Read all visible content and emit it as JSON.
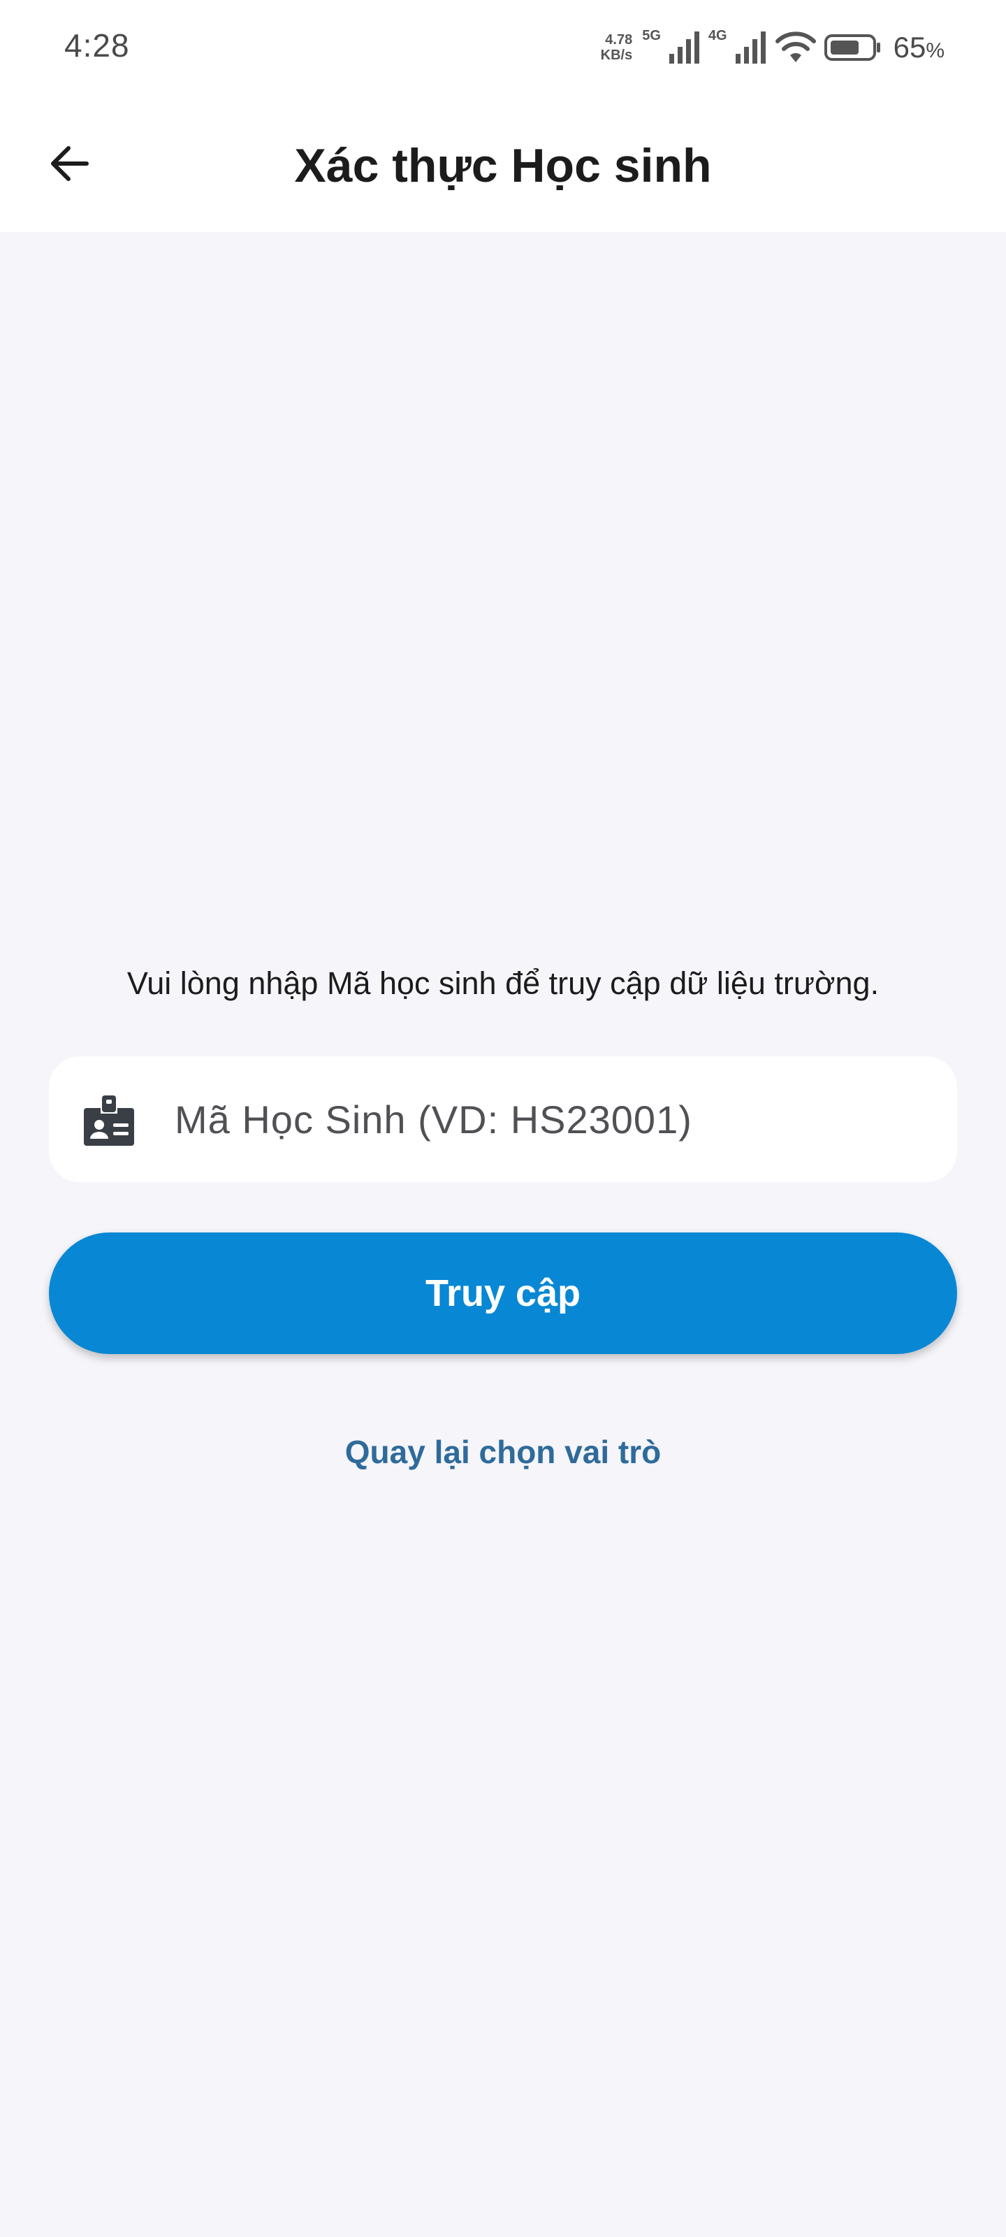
{
  "status_bar": {
    "time": "4:28",
    "net_speed_value": "4.78",
    "net_speed_unit": "KB/s",
    "signal1_label": "5G",
    "signal2_label": "4G",
    "battery_percent": "65",
    "battery_percent_sign": "%",
    "icons": [
      "cell-signal-icon",
      "cell-signal-icon",
      "wifi-icon",
      "battery-icon"
    ]
  },
  "app_bar": {
    "title": "Xác thực Học sinh",
    "back_icon": "arrow-left-icon"
  },
  "main": {
    "instruction": "Vui lòng nhập Mã học sinh để truy cập dữ liệu trường.",
    "student_id_field": {
      "icon": "id-badge-icon",
      "placeholder": "Mã Học Sinh (VD: HS23001)",
      "value": ""
    },
    "access_button_label": "Truy cập",
    "back_to_role_link": "Quay lại chọn vai trò"
  },
  "colors": {
    "background": "#F5F5FA",
    "app_bar": "#FFFFFF",
    "primary_button": "#0887D4",
    "link": "#2F6B9A",
    "text": "#1C1C1C"
  }
}
